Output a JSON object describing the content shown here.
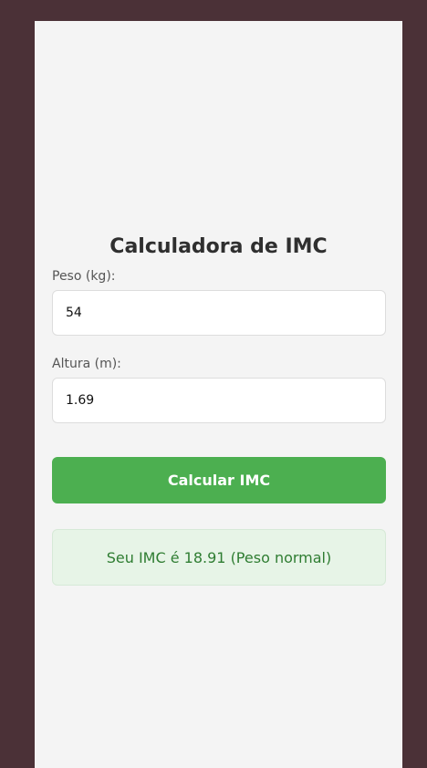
{
  "app": {
    "title": "Calculadora de IMC"
  },
  "form": {
    "weight": {
      "label": "Peso (kg):",
      "value": "54"
    },
    "height": {
      "label": "Altura (m):",
      "value": "1.69"
    },
    "submit_label": "Calcular IMC"
  },
  "result": {
    "text": "Seu IMC é 18.91 (Peso normal)"
  },
  "colors": {
    "background": "#4b3137",
    "card": "#f4f4f4",
    "button": "#4caf50",
    "result_background": "#e7f4e7",
    "result_text": "#2f7d32"
  }
}
